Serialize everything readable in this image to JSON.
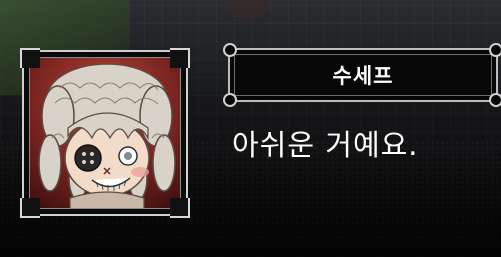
{
  "speaker": {
    "name": "수세프"
  },
  "dialogue": {
    "text": "아쉬운 거예요."
  },
  "portrait": {
    "character": "doll-girl-with-curly-hair-and-button-eye"
  },
  "colors": {
    "nameplate_bg": "#070707",
    "frame": "#cfcfcf",
    "text": "#ffffff"
  }
}
